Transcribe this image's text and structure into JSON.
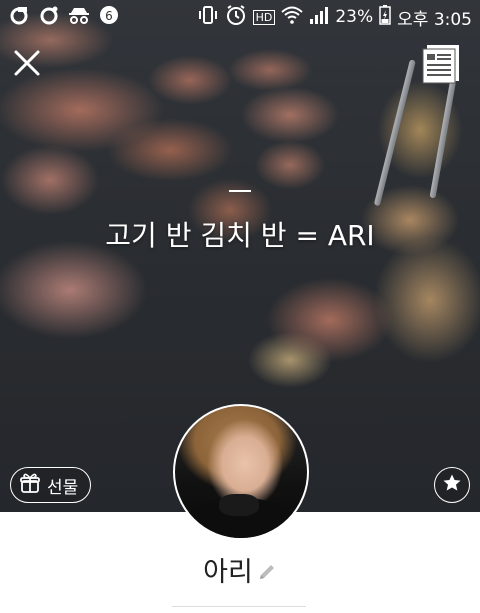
{
  "statusbar": {
    "left_icons": [
      "notification-g-icon",
      "notification-o-icon",
      "incognito-icon",
      "notification-badge-icon"
    ],
    "battery": "23%",
    "time": "오후 3:05",
    "hd_label": "HD"
  },
  "cover": {
    "status_message": "고기 반 김치 반 = ARI"
  },
  "actions": {
    "gift_label": "선물"
  },
  "profile": {
    "name": "아리"
  },
  "colors": {
    "text_dark": "#222222",
    "overlay_white": "#ffffff"
  }
}
